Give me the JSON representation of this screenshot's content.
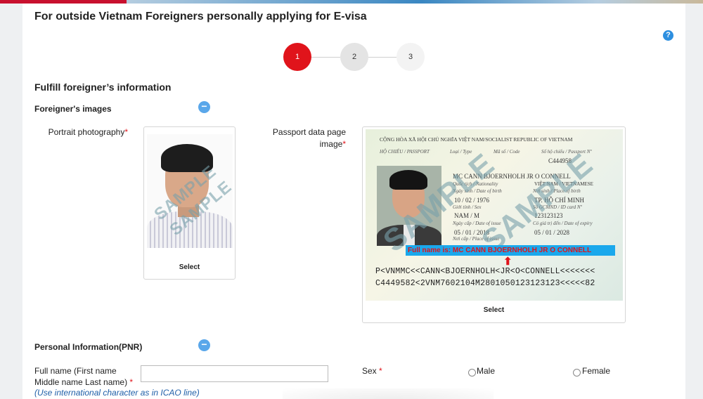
{
  "page": {
    "title": "For outside Vietnam Foreigners personally applying for E-visa",
    "help_icon": "?"
  },
  "steps": [
    {
      "label": "1",
      "state": "active",
      "color": "#e0141b"
    },
    {
      "label": "2",
      "state": "inactive"
    },
    {
      "label": "3",
      "state": "inactive"
    }
  ],
  "section": {
    "title": "Fulfill foreigner’s information"
  },
  "images_section": {
    "title": "Foreigner's images",
    "collapse_icon": "minus-circle-icon",
    "portrait": {
      "label": "Portrait photography",
      "required_mark": "*",
      "watermark": "SAMPLE",
      "select_label": "Select"
    },
    "passport": {
      "label_line1": "Passport data page",
      "label_line2": "image",
      "required_mark": "*",
      "header": "CỘNG HÒA XÃ HỘI CHỦ NGHĨA VIỆT NAM/SOCIALIST REPUBLIC OF VIETNAM",
      "doc_label": "HỘ CHIẾU / PASSPORT",
      "type_label": "Loại / Type",
      "code_label": "Mã số / Code",
      "number_label": "Số hộ chiếu / Passport Nº",
      "passport_number": "C444958",
      "name": "MC CANN BJOERNHOLH JR O CONNELL",
      "nationality_label": "Quốc tịch / Nationality",
      "nationality": "VIỆT NAM / VIETNAMESE",
      "dob_label": "Ngày sinh / Date of birth",
      "dob": "10 / 02 / 1976",
      "pob_label": "Nơi sinh / Place of birth",
      "pob": "TP. HỒ CHÍ MINH",
      "sex_label": "Giới tính / Sex",
      "sex": "NAM / M",
      "id_label": "Số GCMND / ID card Nº",
      "id_number": "123123123",
      "issue_label": "Ngày cấp / Date of issue",
      "issue_date": "05 / 01 / 2018",
      "expiry_label": "Có giá trị đến / Date of expiry",
      "expiry_date": "05 / 01 / 2028",
      "place_issue_label": "Nơi cấp / Place of issue",
      "fullname_note": "Full name is: MC CANN BJOERNHOLH JR O CONNELL",
      "arrow": "⬆",
      "mrz_line1": "P<VNMMC<<CANN<BJOERNHOLH<JR<O<CONNELL<<<<<<<",
      "mrz_line2": "C4449582<2VNM7602104M2801050123123123<<<<<82",
      "watermark": "SAMPLE",
      "select_label": "Select"
    }
  },
  "pnr_section": {
    "title": "Personal Information(PNR)",
    "collapse_icon": "minus-circle-icon",
    "fullname_label_line1": "Full name (First name",
    "fullname_label_line2": "Middle name Last name)",
    "required_mark": "*",
    "fullname_value": "",
    "fullname_hint": "(Use international character as in ICAO line)",
    "sex_label": "Sex",
    "sex_options": [
      "Male",
      "Female"
    ]
  }
}
